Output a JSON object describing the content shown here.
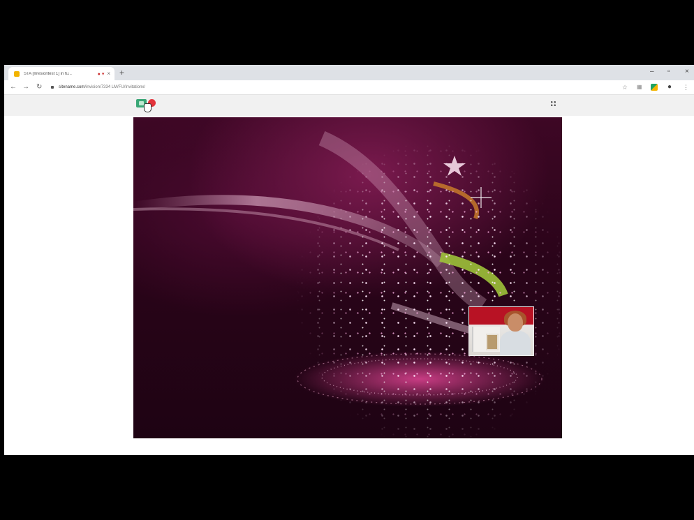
{
  "browser": {
    "tab": {
      "title": "STA [Invisiontest 1] in fu...",
      "indicator": "● ▾",
      "close_icon": "close-icon"
    },
    "new_tab_label": "+",
    "window_controls": {
      "minimize": "–",
      "maximize": "▫",
      "close": "×"
    },
    "toolbar": {
      "back": "←",
      "forward": "→",
      "reload": "↻",
      "url_domain": "sitename.com",
      "url_path": "/invision/7334 LM/FU/Invitationx/",
      "icons": [
        "star-icon",
        "extension-icon",
        "google-drive-icon",
        "profile-icon",
        "menu-icon"
      ]
    }
  },
  "page": {
    "controls": {
      "camera_button": "camera-icon",
      "end_call_button": "end-call-icon",
      "grid_button": "grid-icon"
    },
    "stage": {
      "background": "christmas-tree-sparkles",
      "accent_colors": [
        "#3e0725",
        "#7a1a4e",
        "#e0479a",
        "#9dc23a",
        "#c77a2a"
      ]
    },
    "self_view": {
      "name": "self-view-video"
    }
  }
}
